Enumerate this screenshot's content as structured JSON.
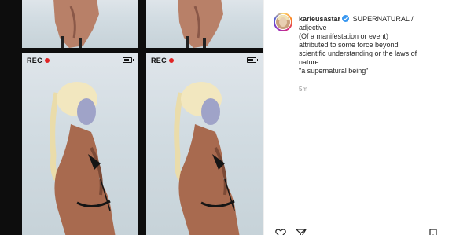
{
  "post": {
    "recording_label": "REC",
    "caption": {
      "username": "karleusastar",
      "title": "SUPERNATURAL /",
      "lines": [
        "adjective",
        "(Of a manifestation or event)",
        "attributed to some force beyond",
        "scientific understanding or the laws of",
        "nature.",
        "\"a supernatural being\""
      ]
    },
    "timestamp": "5m"
  },
  "icons": {
    "verified": "verified-badge-icon",
    "like": "heart-icon",
    "share": "paper-plane-icon",
    "save": "bookmark-icon",
    "rec": "record-dot-icon",
    "battery": "battery-icon"
  },
  "colors": {
    "verified_blue": "#3897f0",
    "rec_red": "#e02424",
    "text": "#262626",
    "muted": "#8e8e8e"
  }
}
